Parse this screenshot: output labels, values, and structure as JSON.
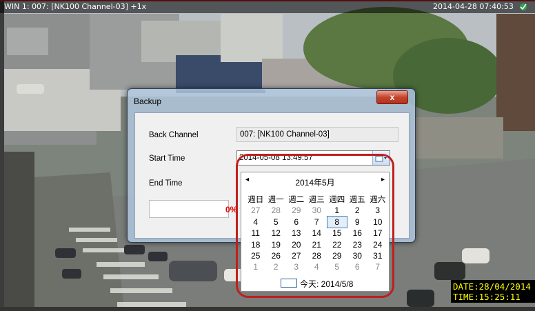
{
  "osd": {
    "window_title": "WIN 1: 007: [NK100 Channel-03] +1x",
    "timestamp": "2014-04-28 07:40:53",
    "date_label": "DATE:28/04/2014",
    "time_label": "TIME:15:25:11",
    "recording_icon": "recording-icon"
  },
  "dialog": {
    "title": "Backup",
    "close_label": "x",
    "back_channel_label": "Back Channel",
    "back_channel_value": "007: [NK100 Channel-03]",
    "start_time_label": "Start Time",
    "start_time_value": "2014-05-08 13:49:57",
    "end_time_label": "End Time",
    "progress_text": "0%",
    "progress": 0
  },
  "calendar": {
    "month_title": "2014年5月",
    "prev": "◂",
    "next": "▸",
    "weekdays": [
      "週日",
      "週一",
      "週二",
      "週三",
      "週四",
      "週五",
      "週六"
    ],
    "weeks": [
      [
        "27",
        "28",
        "29",
        "30",
        "1",
        "2",
        "3"
      ],
      [
        "4",
        "5",
        "6",
        "7",
        "8",
        "9",
        "10"
      ],
      [
        "11",
        "12",
        "13",
        "14",
        "15",
        "16",
        "17"
      ],
      [
        "18",
        "19",
        "20",
        "21",
        "22",
        "23",
        "24"
      ],
      [
        "25",
        "26",
        "27",
        "28",
        "29",
        "30",
        "31"
      ],
      [
        "1",
        "2",
        "3",
        "4",
        "5",
        "6",
        "7"
      ]
    ],
    "selected_day": "8",
    "today_label": "今天: 2014/5/8"
  },
  "colors": {
    "highlight_ring": "#c01e1e",
    "osd_text": "#ffff00",
    "progress_text": "#e60000"
  }
}
